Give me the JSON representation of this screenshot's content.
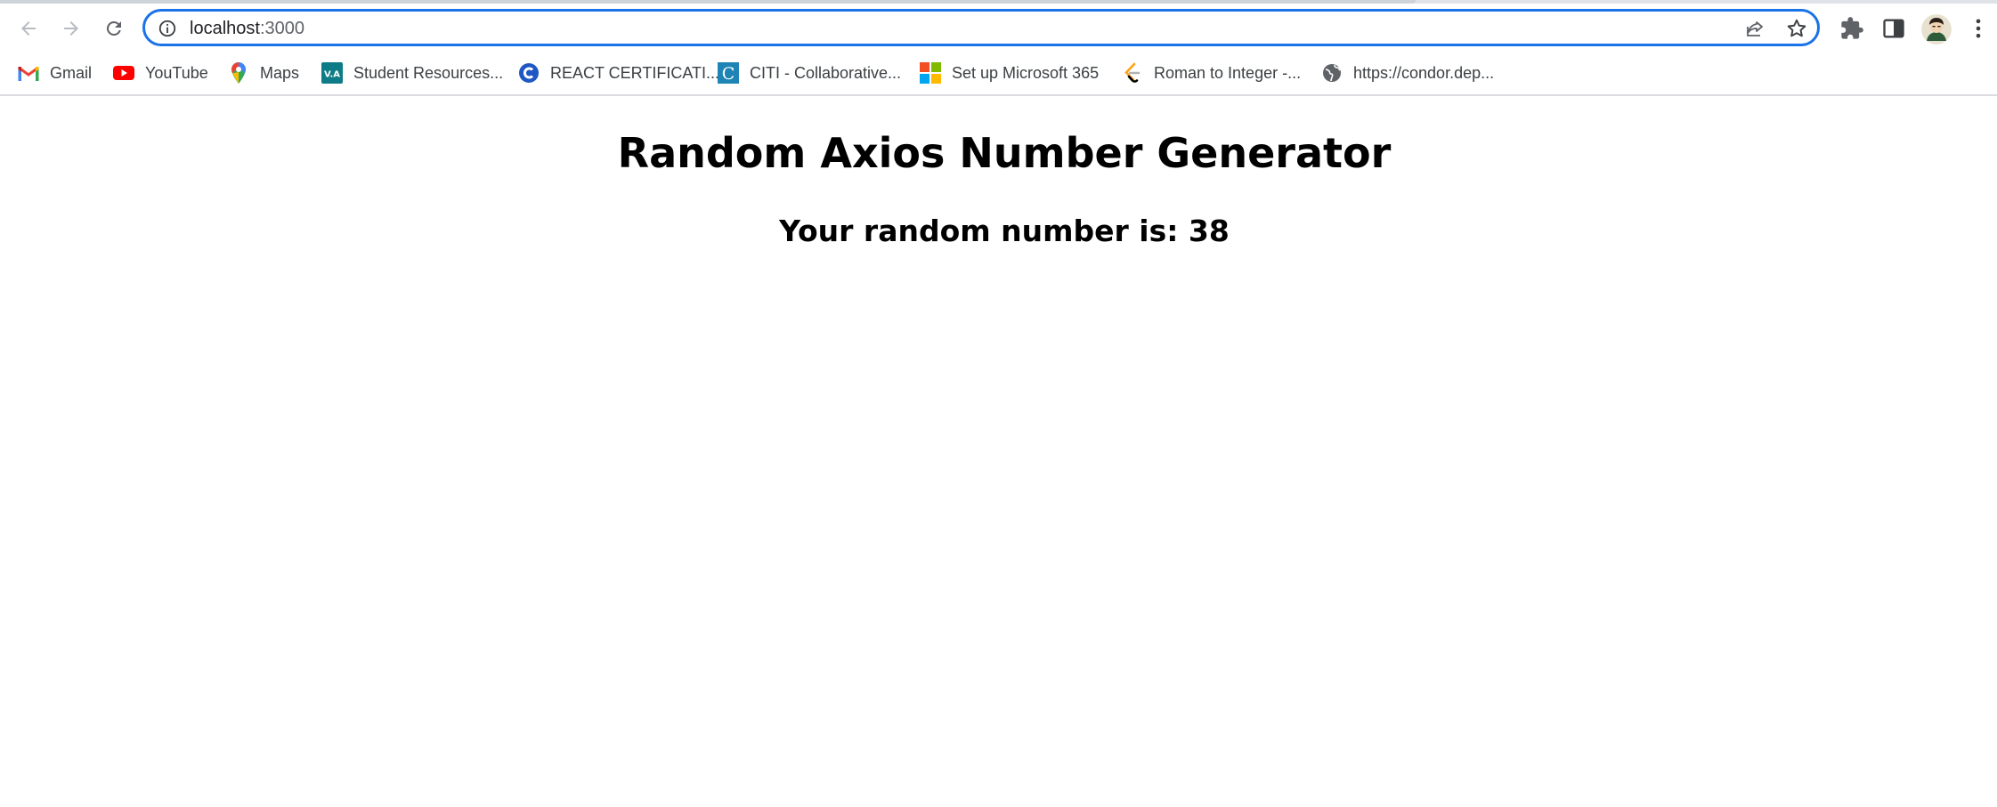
{
  "browser": {
    "url_host": "localhost",
    "url_port": ":3000",
    "icons": {
      "back": "arrow-left-icon",
      "forward": "arrow-right-icon",
      "reload": "reload-icon",
      "site_info": "info-icon",
      "share": "share-icon",
      "bookmark": "star-icon",
      "extensions": "puzzle-icon",
      "side_panel": "side-panel-icon",
      "menu": "kebab-menu-icon"
    },
    "accent_color": "#1a73e8"
  },
  "bookmarks": [
    {
      "label": "Gmail",
      "icon": "gmail-icon"
    },
    {
      "label": "YouTube",
      "icon": "youtube-icon"
    },
    {
      "label": "Maps",
      "icon": "maps-icon"
    },
    {
      "label": "Student Resources...",
      "icon": "va-icon",
      "icon_text": "V.A"
    },
    {
      "label": "REACT CERTIFICATI...",
      "icon": "c-circle-icon"
    },
    {
      "label": "CITI - Collaborative...",
      "icon": "citi-icon",
      "icon_text": "C"
    },
    {
      "label": "Set up Microsoft 365",
      "icon": "microsoft-icon"
    },
    {
      "label": "Roman to Integer -...",
      "icon": "leetcode-icon"
    },
    {
      "label": "https://condor.dep...",
      "icon": "globe-icon"
    }
  ],
  "page": {
    "title": "Random Axios Number Generator",
    "random_number_text": "Your random number is: 38"
  }
}
